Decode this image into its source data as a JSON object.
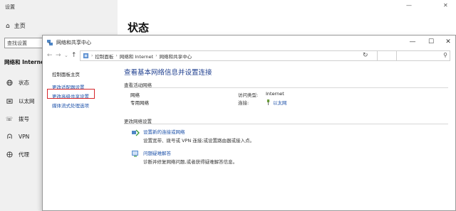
{
  "settings": {
    "title": "设置",
    "home": "主页",
    "search_placeholder": "查找设置",
    "section": "网络和 Internet",
    "nav": [
      {
        "label": "状态",
        "icon": "globe-icon"
      },
      {
        "label": "以太网",
        "icon": "ethernet-icon"
      },
      {
        "label": "拨号",
        "icon": "phone-icon"
      },
      {
        "label": "VPN",
        "icon": "vpn-icon"
      },
      {
        "label": "代理",
        "icon": "proxy-globe-icon"
      }
    ],
    "heading": "状态",
    "window_controls": {
      "minimize": "—",
      "close": "✕"
    }
  },
  "cp": {
    "title": "网络和共享中心",
    "window_controls": {
      "minimize": "—",
      "maximize": "☐",
      "close": "✕"
    },
    "nav": {
      "back": "←",
      "forward": "→",
      "recent": "⌄",
      "up": "↑"
    },
    "breadcrumb": [
      "控制面板",
      "网络和 Internet",
      "网络和共享中心"
    ],
    "breadcrumb_sep": "›",
    "refresh": "↻",
    "search_icon": "⚲",
    "left_pane": [
      "控制面板主页",
      "更改适配器设置",
      "更改高级共享设置",
      "媒体流式处理选项"
    ],
    "highlight_color": "#d6262b",
    "main_title": "查看基本网络信息并设置连接",
    "active_network_header": "查看活动网络",
    "network_name": "网络",
    "network_type": "专用网络",
    "access_type_label": "访问类型:",
    "access_type_value": "Internet",
    "connection_label": "连接:",
    "connection_value": "以太网",
    "change_settings_header": "更改网络设置",
    "tasks": [
      {
        "title": "设置新的连接或网络",
        "desc": "设置宽带、拨号或 VPN 连接;或设置路由器或接入点。",
        "icon": "new-connection-icon"
      },
      {
        "title": "问题疑难解答",
        "desc": "诊断并修复网络问题,或者获得疑难解答信息。",
        "icon": "troubleshoot-icon"
      }
    ]
  }
}
